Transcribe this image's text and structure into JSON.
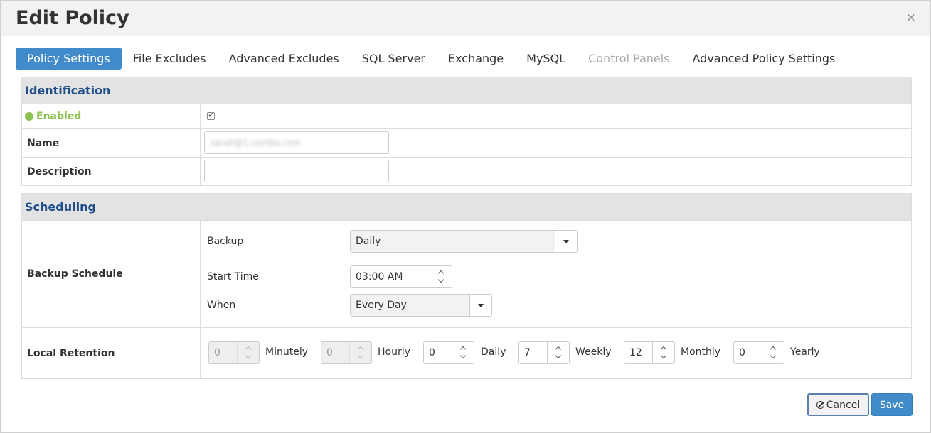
{
  "modal": {
    "title": "Edit Policy",
    "close_label": "×"
  },
  "tabs": [
    {
      "label": "Policy Settings",
      "state": "active"
    },
    {
      "label": "File Excludes",
      "state": "normal"
    },
    {
      "label": "Advanced Excludes",
      "state": "normal"
    },
    {
      "label": "SQL Server",
      "state": "normal"
    },
    {
      "label": "Exchange",
      "state": "normal"
    },
    {
      "label": "MySQL",
      "state": "normal"
    },
    {
      "label": "Control Panels",
      "state": "disabled"
    },
    {
      "label": "Advanced Policy Settings",
      "state": "normal"
    }
  ],
  "identification": {
    "heading": "Identification",
    "enabled_label": "Enabled",
    "enabled_checked": true,
    "checkbox_glyph": "✔",
    "name_label": "Name",
    "name_value": "sarah@1.combo.com",
    "description_label": "Description",
    "description_value": ""
  },
  "scheduling": {
    "heading": "Scheduling",
    "backup_schedule_label": "Backup Schedule",
    "backup_label": "Backup",
    "backup_value": "Daily",
    "start_time_label": "Start Time",
    "start_time_value": "03:00 AM",
    "when_label": "When",
    "when_value": "Every Day",
    "local_retention_label": "Local Retention",
    "retention": {
      "minutely": {
        "label": "Minutely",
        "value": "0"
      },
      "hourly": {
        "label": "Hourly",
        "value": "0"
      },
      "daily": {
        "label": "Daily",
        "value": "0"
      },
      "weekly": {
        "label": "Weekly",
        "value": "7"
      },
      "monthly": {
        "label": "Monthly",
        "value": "12"
      },
      "yearly": {
        "label": "Yearly",
        "value": "0"
      }
    }
  },
  "footer": {
    "cancel_label": "Cancel",
    "save_label": "Save"
  },
  "colors": {
    "accent": "#428bca",
    "enabled_green": "#8cc152",
    "heading_blue": "#1f4e8a",
    "panel_heading_bg": "#e3e3e3"
  }
}
